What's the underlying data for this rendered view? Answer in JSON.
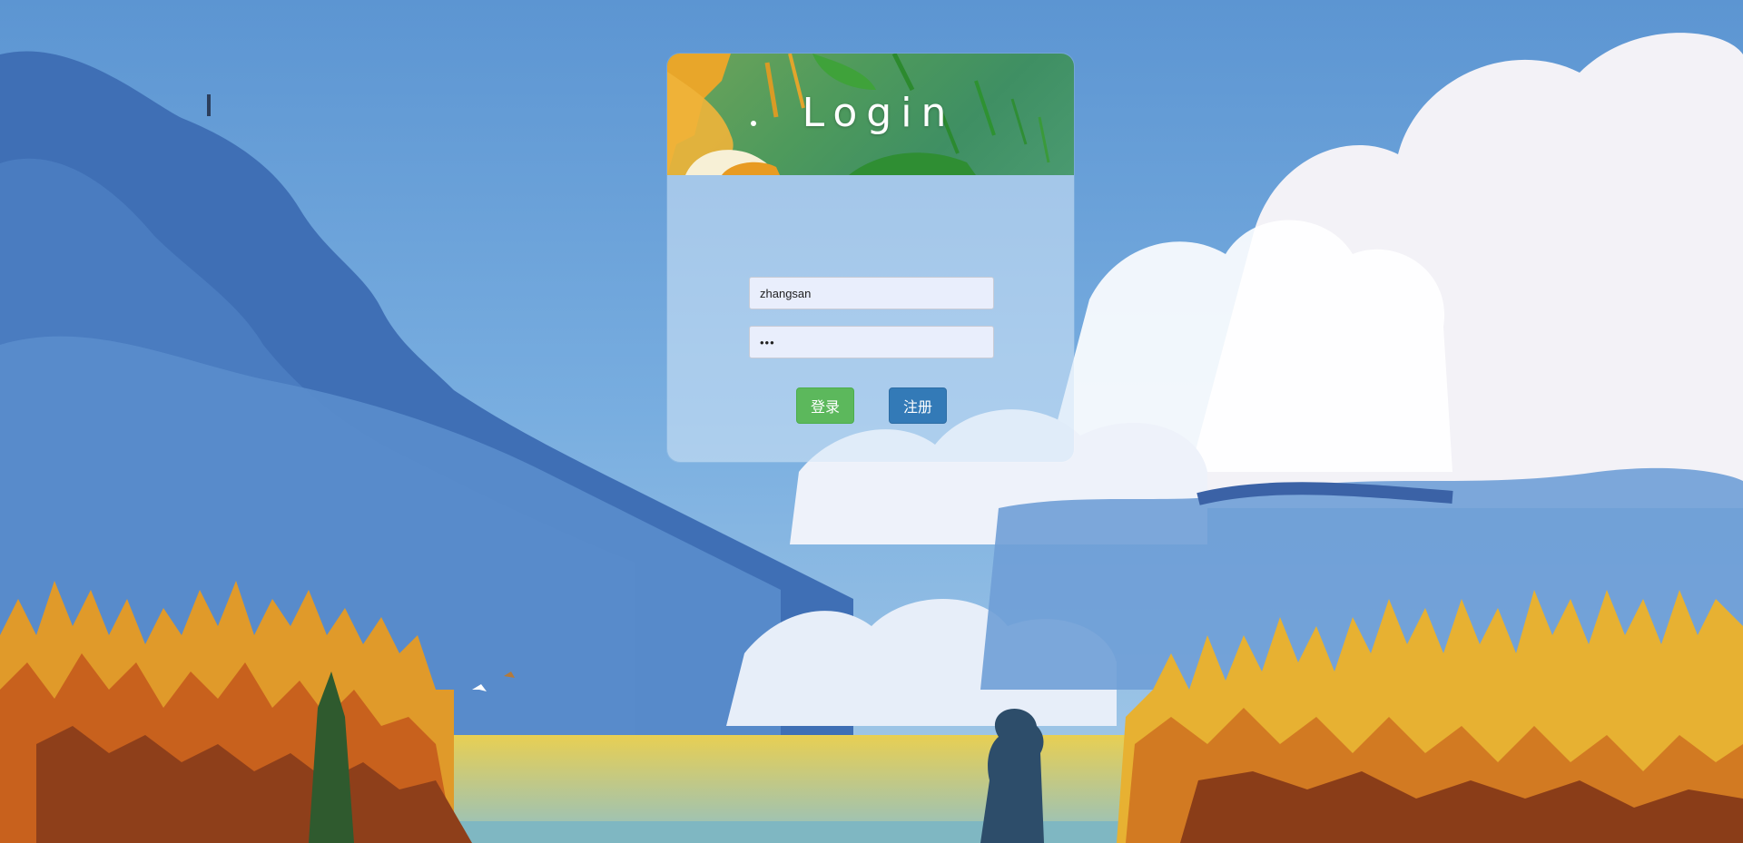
{
  "login": {
    "title": "Login",
    "username_value": "zhangsan",
    "password_value": "•••",
    "login_button": "登录",
    "register_button": "注册"
  },
  "colors": {
    "login_button": "#5cb85c",
    "register_button": "#337ab7",
    "sky": "#5f9bd6"
  }
}
